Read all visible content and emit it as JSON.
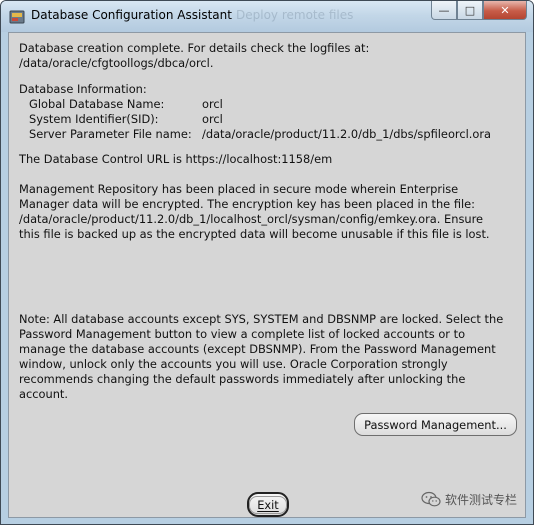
{
  "window": {
    "title": "Database Configuration Assistant",
    "background_title": "Deploy remote files",
    "buttons": {
      "minimize": "—",
      "maximize": "□",
      "close": "✕"
    }
  },
  "content": {
    "creation_line1": "Database creation complete. For details check the logfiles at:",
    "creation_line2": " /data/oracle/cfgtoollogs/dbca/orcl.",
    "db_info_header": "Database Information:",
    "global_db_name_label": "Global Database Name:",
    "global_db_name_value": "orcl",
    "sid_label": "System Identifier(SID):",
    "sid_value": "orcl",
    "spfile_label": "Server Parameter File name:",
    "spfile_value": "/data/oracle/product/11.2.0/db_1/dbs/spfileorcl.ora",
    "control_url": "The Database Control URL is https://localhost:1158/em",
    "repo_lines": [
      "Management Repository has been placed in secure mode wherein Enterprise",
      "Manager data will be encrypted.  The encryption key has been placed in the file:",
      "/data/oracle/product/11.2.0/db_1/localhost_orcl/sysman/config/emkey.ora. Ensure",
      "this file is backed up as the encrypted data will become unusable if this file is lost."
    ],
    "note_lines": [
      "Note: All database accounts except SYS, SYSTEM and DBSNMP are locked. Select the",
      "Password Management button to view a complete list of locked accounts or to",
      "manage the database accounts (except DBSNMP). From the Password Management",
      "window, unlock only the accounts you will use. Oracle Corporation strongly",
      "recommends changing the default passwords immediately after unlocking the",
      "account."
    ]
  },
  "buttons": {
    "password_management": "Password Management...",
    "exit": "Exit"
  },
  "watermark": {
    "text": "软件测试专栏"
  },
  "colors": {
    "dialog_bg": "#d6d6d6",
    "titlebar": "#c3d7e8",
    "close_button": "#c75c48"
  }
}
